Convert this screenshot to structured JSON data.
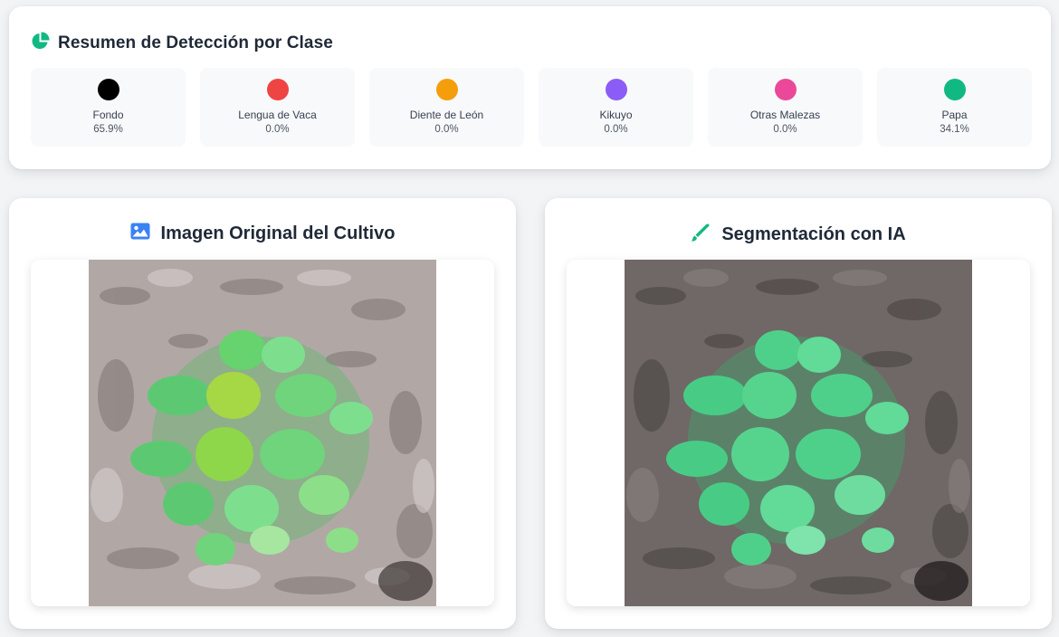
{
  "summary": {
    "title": "Resumen de Detección por Clase",
    "icon": "chart-pie-icon",
    "classes": [
      {
        "name": "Fondo",
        "percent": "65.9%",
        "color": "#000000"
      },
      {
        "name": "Lengua de Vaca",
        "percent": "0.0%",
        "color": "#ef4444"
      },
      {
        "name": "Diente de León",
        "percent": "0.0%",
        "color": "#f59e0b"
      },
      {
        "name": "Kikuyo",
        "percent": "0.0%",
        "color": "#8b5cf6"
      },
      {
        "name": "Otras Malezas",
        "percent": "0.0%",
        "color": "#ec4899"
      },
      {
        "name": "Papa",
        "percent": "34.1%",
        "color": "#10b981"
      }
    ]
  },
  "original_panel": {
    "title": "Imagen Original del Cultivo",
    "icon": "image-icon"
  },
  "segmentation_panel": {
    "title": "Segmentación con IA",
    "icon": "paint-brush-icon"
  },
  "colors": {
    "accent_green": "#10b981",
    "accent_blue": "#3b82f6"
  }
}
